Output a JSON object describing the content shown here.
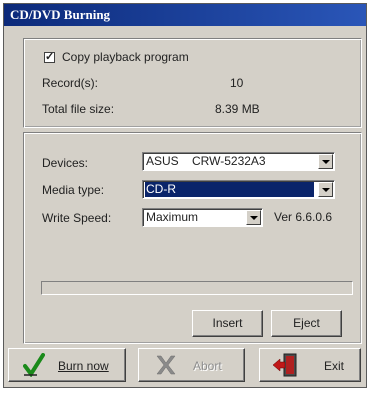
{
  "window": {
    "title": "CD/DVD Burning"
  },
  "summary": {
    "copy_playback_label": "Copy playback program",
    "copy_playback_checked": true,
    "records_label": "Record(s):",
    "records_value": "10",
    "total_size_label": "Total file size:",
    "total_size_value": "8.39 MB"
  },
  "settings": {
    "devices_label": "Devices:",
    "devices_value": "ASUS    CRW-5232A3",
    "media_label": "Media type:",
    "media_value": "CD-R",
    "speed_label": "Write Speed:",
    "speed_value": "Maximum",
    "version": "Ver 6.6.0.6",
    "progress": 0
  },
  "actions": {
    "insert_label": "Insert",
    "eject_label": "Eject"
  },
  "footer": {
    "burn_label": "Burn now",
    "abort_label": "Abort",
    "exit_label": "Exit"
  }
}
